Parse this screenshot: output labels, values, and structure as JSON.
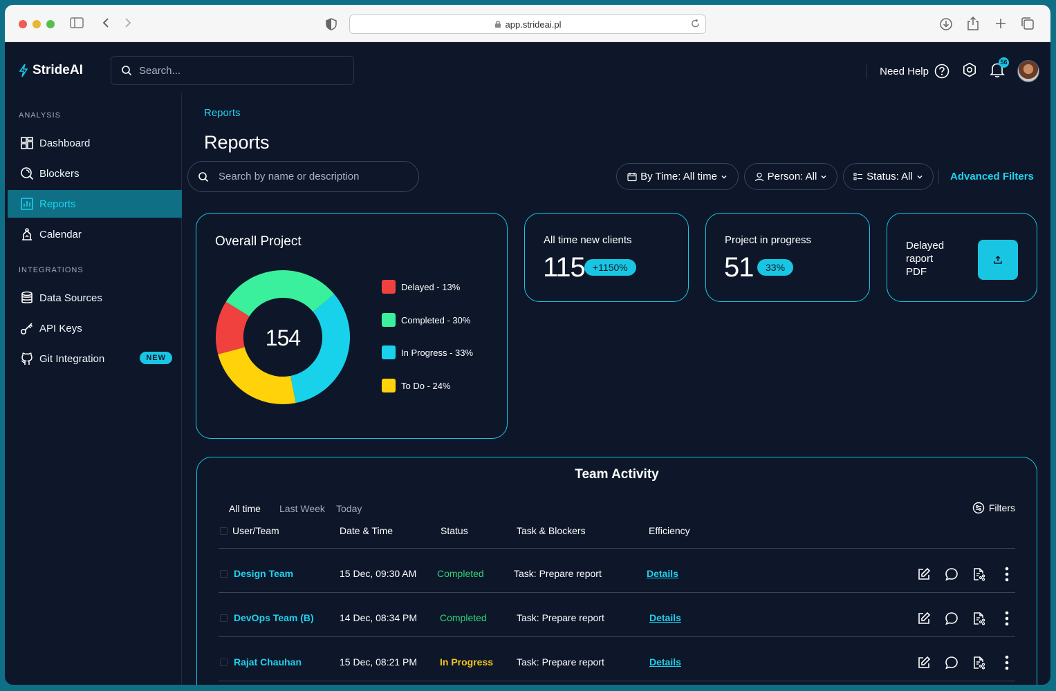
{
  "browser": {
    "url": "app.strideai.pl"
  },
  "app": {
    "name": "StrideAI",
    "search_placeholder": "Search...",
    "need_help": "Need Help",
    "notification_count": "56"
  },
  "sidebar": {
    "sections": [
      {
        "label": "ANALYSIS",
        "items": [
          {
            "label": "Dashboard",
            "icon": "dashboard-icon"
          },
          {
            "label": "Blockers",
            "icon": "blockers-icon"
          },
          {
            "label": "Reports",
            "icon": "reports-icon",
            "active": true
          },
          {
            "label": "Calendar",
            "icon": "calendar-icon"
          }
        ]
      },
      {
        "label": "INTEGRATIONS",
        "items": [
          {
            "label": "Data Sources",
            "icon": "database-icon"
          },
          {
            "label": "API Keys",
            "icon": "key-icon"
          },
          {
            "label": "Git Integration",
            "icon": "github-icon",
            "badge": "NEW"
          }
        ]
      }
    ]
  },
  "main": {
    "breadcrumb": "Reports",
    "title": "Reports",
    "search_placeholder": "Search by name or description",
    "filters": {
      "time": "By Time: All time",
      "person": "Person: All",
      "status": "Status: All",
      "advanced": "Advanced Filters"
    }
  },
  "overall": {
    "title": "Overall Project",
    "total": "154",
    "legend": [
      {
        "label": "Delayed - 13%",
        "color": "#f0413f",
        "value": 13
      },
      {
        "label": "Completed - 30%",
        "color": "#3bf09c",
        "value": 30
      },
      {
        "label": "In Progress - 33%",
        "color": "#18d2ec",
        "value": 33
      },
      {
        "label": "To Do - 24%",
        "color": "#ffd20a",
        "value": 24
      }
    ]
  },
  "stats": {
    "clients": {
      "label": "All time new clients",
      "value": "115",
      "badge": "+1150%"
    },
    "progress": {
      "label": "Project in progress",
      "value": "51",
      "badge": "33%"
    },
    "delayed": {
      "line1": "Delayed",
      "line2": "raport",
      "line3": "PDF"
    }
  },
  "team_activity": {
    "title": "Team Activity",
    "tabs": [
      "All time",
      "Last Week",
      "Today"
    ],
    "filters_label": "Filters",
    "columns": [
      "User/Team",
      "Date & Time",
      "Status",
      "Task & Blockers",
      "Efficiency"
    ],
    "rows": [
      {
        "team": "Design Team",
        "date": "15 Dec, 09:30 AM",
        "status": "Completed",
        "task": "Task: Prepare report",
        "efficiency": "Details"
      },
      {
        "team": "DevOps Team (B)",
        "date": "14 Dec, 08:34 PM",
        "status": "Completed",
        "task": "Task: Prepare report",
        "efficiency": "Details"
      },
      {
        "team": "Rajat Chauhan",
        "date": "15 Dec, 08:21 PM",
        "status": "In Progress",
        "task": "Task: Prepare report",
        "efficiency": "Details"
      }
    ]
  },
  "colors": {
    "accent": "#18c6e3",
    "background": "#0e1729",
    "frame": "#0f6f86"
  }
}
